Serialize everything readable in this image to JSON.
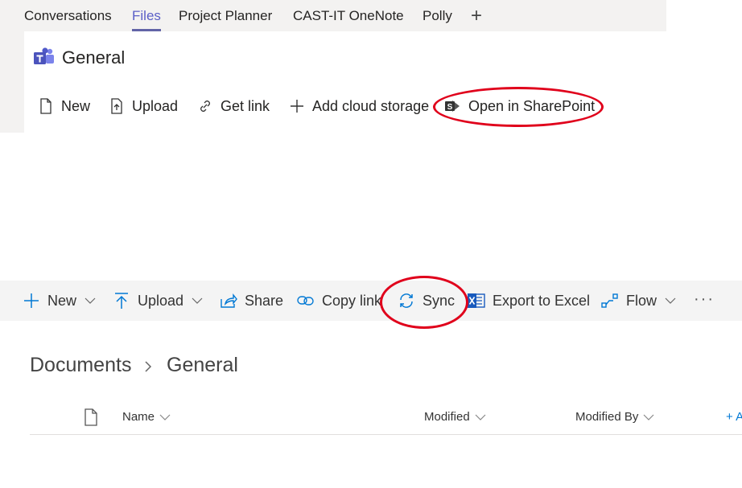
{
  "teams": {
    "tabs": [
      "Conversations",
      "Files",
      "Project Planner",
      "CAST-IT OneNote",
      "Polly"
    ],
    "active_tab": "Files",
    "add_tab_glyph": "+",
    "channel_name": "General",
    "commands": {
      "new": "New",
      "upload": "Upload",
      "get_link": "Get link",
      "add_cloud_storage": "Add cloud storage",
      "open_in_sharepoint": "Open in SharePoint"
    }
  },
  "sharepoint": {
    "commands": {
      "new": "New",
      "upload": "Upload",
      "share": "Share",
      "copy_link": "Copy link",
      "sync": "Sync",
      "export_to_excel": "Export to Excel",
      "flow": "Flow",
      "more": "···"
    },
    "breadcrumb": [
      "Documents",
      "General"
    ],
    "columns": {
      "name": "Name",
      "modified": "Modified",
      "modified_by": "Modified By",
      "add_column": "+ A"
    }
  },
  "colors": {
    "teams_accent": "#6264a7",
    "sharepoint_icon_blue": "#0078d4",
    "highlight_red": "#e0001b",
    "excel_blue": "#185abd"
  },
  "icons": [
    "new-file-icon",
    "upload-icon",
    "link-icon",
    "plus-icon",
    "sharepoint-icon",
    "sync-icon",
    "excel-icon",
    "flow-icon",
    "share-icon",
    "chevron-down-icon",
    "chevron-right-icon",
    "document-icon",
    "teams-logo-icon"
  ]
}
